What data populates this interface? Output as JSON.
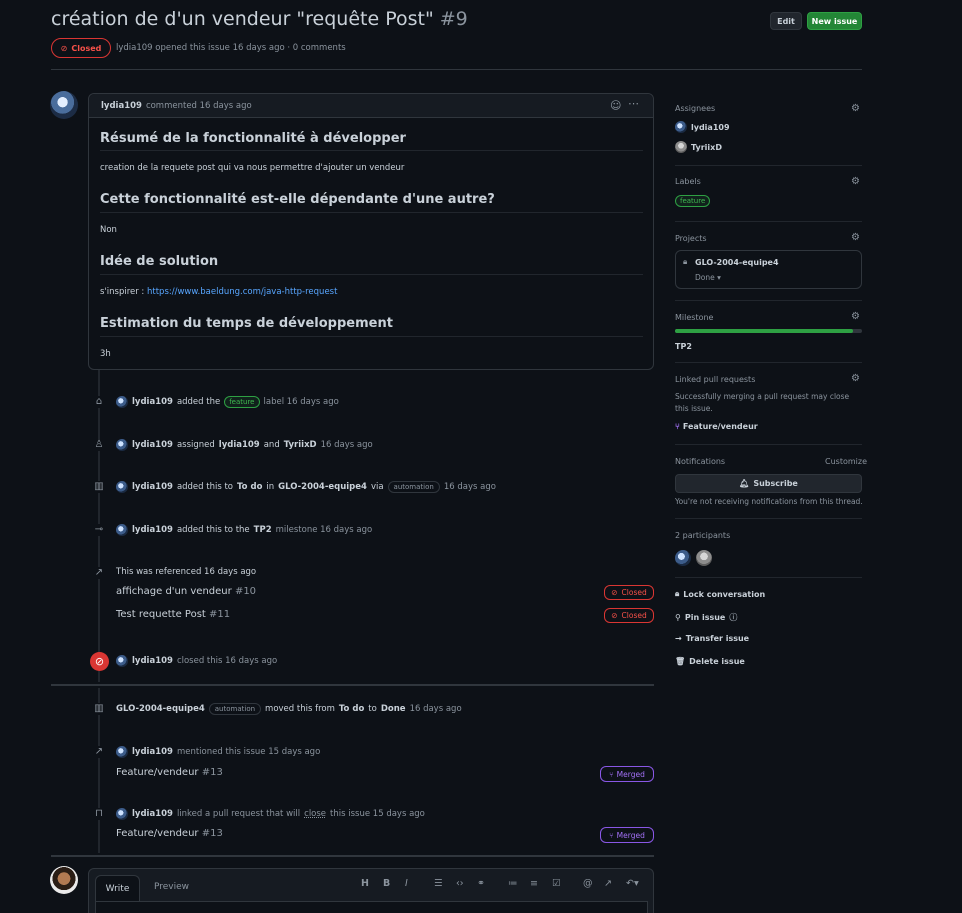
{
  "header": {
    "title": "création de d'un vendeur \"requête Post\"",
    "number": "#9",
    "edit_label": "Edit",
    "new_issue_label": "New issue",
    "state_label": "Closed",
    "meta_author": "lydia109",
    "meta_text": "opened this issue 16 days ago · 0 comments"
  },
  "comment": {
    "author": "lydia109",
    "time": "commented 16 days ago",
    "h_summary": "Résumé de la fonctionnalité à développer",
    "p_summary": "creation de la requete post qui va nous permettre d'ajouter un vendeur",
    "h_dependency": "Cette fonctionnalité est-elle dépendante d'une autre?",
    "p_dependency": "Non",
    "h_solution": "Idée de solution",
    "p_solution_prefix": "s'inspirer : ",
    "p_solution_link": "https://www.baeldung.com/java-http-request",
    "h_estimate": "Estimation du temps de développement",
    "p_estimate": "3h"
  },
  "timeline": {
    "e1": {
      "actor": "lydia109",
      "pre": "added the",
      "label": "feature",
      "post": "label 16 days ago"
    },
    "e2": {
      "actor": "lydia109",
      "pre": "assigned",
      "user1": "lydia109",
      "and": "and",
      "user2": "TyriixD",
      "time": "16 days ago"
    },
    "e3": {
      "actor": "lydia109",
      "pre": "added this to",
      "col": "To do",
      "in": "in",
      "project": "GLO-2004-equipe4",
      "via": "via",
      "badge": "automation",
      "time": "16 days ago"
    },
    "e4": {
      "actor": "lydia109",
      "pre": "added this to the",
      "milestone": "TP2",
      "post": "milestone 16 days ago"
    },
    "e5": {
      "text": "This was referenced 16 days ago",
      "refs": [
        {
          "title": "affichage d'un vendeur",
          "num": "#10",
          "state": "Closed"
        },
        {
          "title": "Test requette Post",
          "num": "#11",
          "state": "Closed"
        }
      ]
    },
    "e6": {
      "actor": "lydia109",
      "text": "closed this 16 days ago"
    },
    "e7": {
      "actor": "GLO-2004-equipe4",
      "badge": "automation",
      "pre": "moved this from",
      "from": "To do",
      "to_word": "to",
      "to": "Done",
      "time": "16 days ago"
    },
    "e8": {
      "actor": "lydia109",
      "text": "mentioned this issue 15 days ago",
      "ref_title": "Feature/vendeur",
      "ref_num": "#13",
      "state": "Merged"
    },
    "e9": {
      "actor": "lydia109",
      "text": "linked a pull request that will",
      "close": "close",
      "text2": "this issue 15 days ago",
      "ref_title": "Feature/vendeur",
      "ref_num": "#13",
      "state": "Merged"
    }
  },
  "editor": {
    "tab_write": "Write",
    "tab_preview": "Preview"
  },
  "sidebar": {
    "assignees_title": "Assignees",
    "assignee1": "lydia109",
    "assignee2": "TyriixD",
    "labels_title": "Labels",
    "label1": "feature",
    "projects_title": "Projects",
    "project_name": "GLO-2004-equipe4",
    "project_status": "Done",
    "milestone_title": "Milestone",
    "milestone_progress": 0.95,
    "milestone_name": "TP2",
    "linked_title": "Linked pull requests",
    "linked_desc": "Successfully merging a pull request may close this issue.",
    "linked_pr": "Feature/vendeur",
    "notif_title": "Notifications",
    "customize": "Customize",
    "subscribe": "Subscribe",
    "notif_desc": "You're not receiving notifications from this thread.",
    "participants": "2 participants",
    "lock": "Lock conversation",
    "pin": "Pin issue",
    "transfer": "Transfer issue",
    "delete": "Delete issue"
  }
}
